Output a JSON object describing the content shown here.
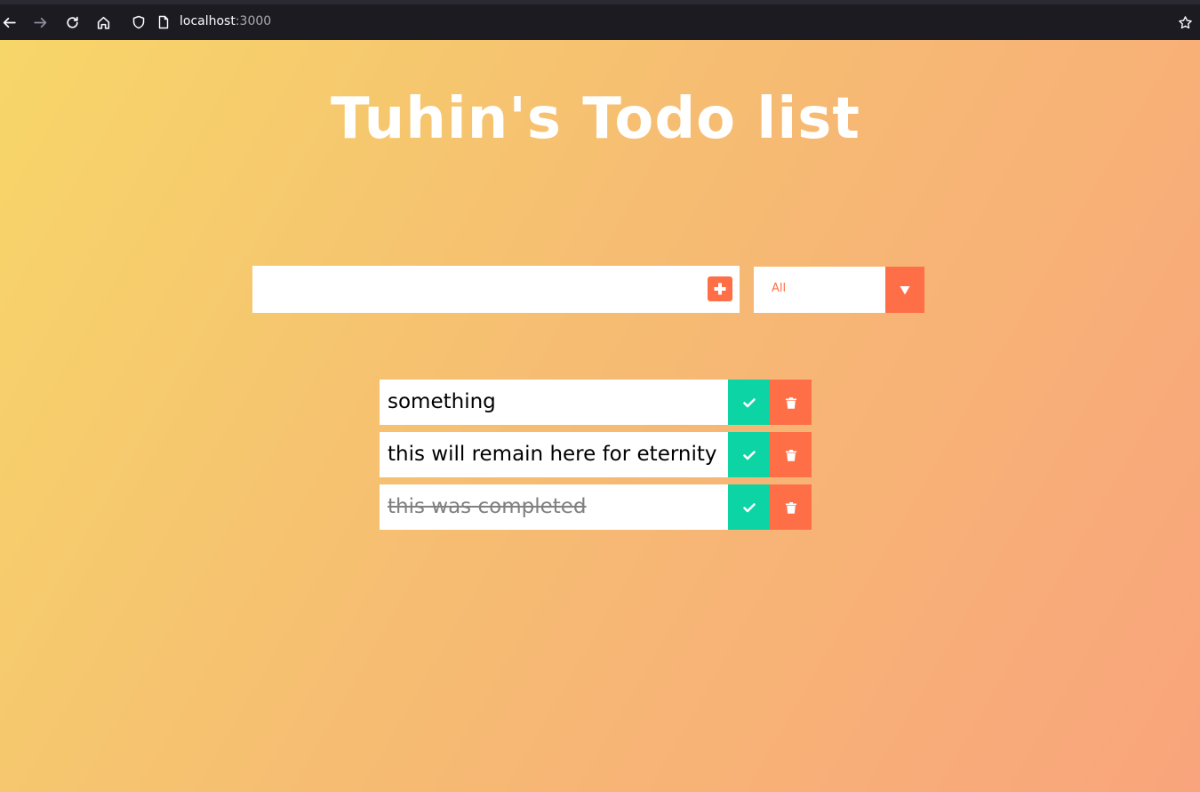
{
  "browser": {
    "url_host": "localhost",
    "url_port": ":3000"
  },
  "app": {
    "title": "Tuhin's Todo list",
    "input": {
      "value": "",
      "placeholder": ""
    },
    "filter": {
      "selected": "All"
    },
    "todos": [
      {
        "text": "something",
        "completed": false
      },
      {
        "text": "this will remain here for eternity",
        "completed": false
      },
      {
        "text": "this was completed",
        "completed": true
      }
    ]
  },
  "colors": {
    "accent": "#ff6f47",
    "complete": "#0cd4a4",
    "gradient_start": "#f7d669",
    "gradient_end": "#f9a47c"
  },
  "icons": {
    "add": "plus-square-icon",
    "filter_arrow": "caret-down-icon",
    "complete": "check-icon",
    "trash": "trash-icon"
  }
}
